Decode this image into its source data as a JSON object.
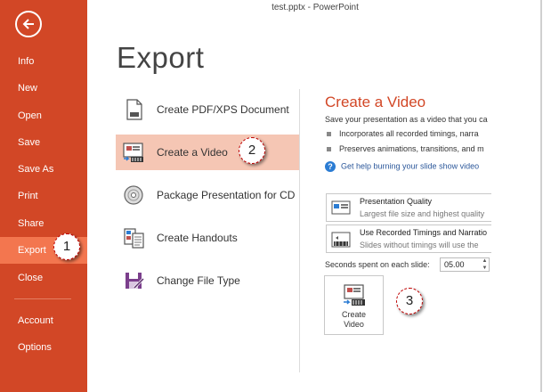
{
  "window": {
    "title": "test.pptx - PowerPoint"
  },
  "sidebar": {
    "items": [
      {
        "label": "Info"
      },
      {
        "label": "New"
      },
      {
        "label": "Open"
      },
      {
        "label": "Save"
      },
      {
        "label": "Save As"
      },
      {
        "label": "Print"
      },
      {
        "label": "Share"
      },
      {
        "label": "Export",
        "active": true
      },
      {
        "label": "Close"
      },
      {
        "label": "Account"
      },
      {
        "label": "Options"
      }
    ]
  },
  "page_title": "Export",
  "export_options": [
    {
      "label": "Create PDF/XPS Document",
      "icon": "pdf-document-icon"
    },
    {
      "label": "Create a Video",
      "icon": "video-icon",
      "selected": true
    },
    {
      "label": "Package Presentation for CD",
      "icon": "cd-icon"
    },
    {
      "label": "Create Handouts",
      "icon": "handouts-icon"
    },
    {
      "label": "Change File Type",
      "icon": "change-file-type-icon"
    }
  ],
  "panel": {
    "title": "Create a Video",
    "description": "Save your presentation as a video that you ca",
    "bullets": [
      "Incorporates all recorded timings, narra",
      "Preserves animations, transitions, and m"
    ],
    "help_link": "Get help burning your slide show video",
    "quality_dropdown": {
      "main": "Presentation Quality",
      "sub": "Largest file size and highest quality"
    },
    "timings_dropdown": {
      "main": "Use Recorded Timings and Narratio",
      "sub": "Slides without timings will use the"
    },
    "seconds_label": "Seconds spent on each slide:",
    "seconds_value": "05.00",
    "create_button_line1": "Create",
    "create_button_line2": "Video"
  },
  "callouts": {
    "one": "1",
    "two": "2",
    "three": "3"
  },
  "colors": {
    "sidebar": "#D24726",
    "sidebar_active": "#F3764F",
    "selected_option": "#F5C6B4",
    "accent_title": "#D24726",
    "link": "#2B579A"
  }
}
